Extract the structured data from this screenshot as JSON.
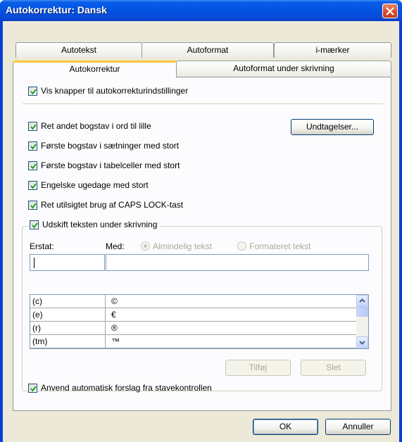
{
  "window": {
    "title": "Autokorrektur: Dansk"
  },
  "tabs_back": [
    "Autotekst",
    "Autoformat",
    "i-mærker"
  ],
  "tabs_front": [
    "Autokorrektur",
    "Autoformat under skrivning"
  ],
  "options": {
    "show_buttons": "Vis knapper til autokorrekturindstillinger",
    "second_letter": "Ret andet bogstav i ord til lille",
    "sentence_caps": "Første bogstav i sætninger med stort",
    "cell_caps": "Første bogstav i tabelceller med stort",
    "weekdays": "Engelske ugedage med stort",
    "caps_lock": "Ret utilsigtet brug af CAPS LOCK-tast",
    "replace_text": "Udskift teksten under skrivning",
    "spellcheck": "Anvend automatisk forslag fra stavekontrollen"
  },
  "buttons": {
    "exceptions": "Undtagelser...",
    "add": "Tilføj",
    "delete": "Slet",
    "ok": "OK",
    "cancel": "Annuller"
  },
  "replace": {
    "replace_label": "Erstat:",
    "with_label": "Med:",
    "plain_text": "Almindelig tekst",
    "formatted_text": "Formateret tekst",
    "replace_value": "",
    "with_value": ""
  },
  "entries": [
    {
      "replace": "(c)",
      "with": "©"
    },
    {
      "replace": "(e)",
      "with": "€"
    },
    {
      "replace": "(r)",
      "with": "®"
    },
    {
      "replace": "(tm)",
      "with": "™"
    }
  ],
  "icons": [
    "close-icon",
    "checkmark-icon",
    "scroll-up-icon",
    "scroll-down-icon"
  ]
}
